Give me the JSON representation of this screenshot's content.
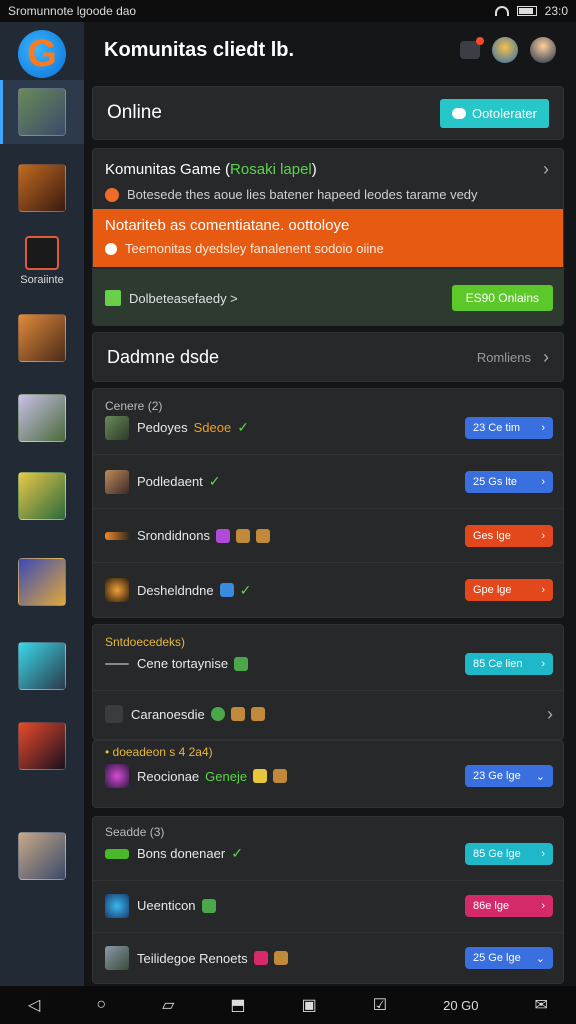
{
  "statusbar": {
    "left_text": "Sromunnote lgoode dao",
    "time": "23:0"
  },
  "sidebar": {
    "label": "Soraiinte",
    "logo_glyph": "G"
  },
  "header": {
    "title": "Komunitas cliedt lb."
  },
  "online": {
    "title": "Online",
    "button": "Ootolerater"
  },
  "community": {
    "title_prefix": "Komunitas Game (",
    "title_highlight": "Rosaki lapel",
    "title_suffix": ")",
    "subtitle": "Botesede thes aoue lies batener hapeed leodes tarame vedy",
    "alert_title": "Notariteb as comentiatane. oottoloye",
    "alert_sub": "Teemonitas dyedsley fanalenent sodoio oiine",
    "status_text": "Dolbeteasefaedy >",
    "status_button": "ES90 Onlains"
  },
  "section_header": {
    "title": "Dadmne dsde",
    "right": "Romliens"
  },
  "group1": {
    "title": "Cenere (2)",
    "rows": [
      {
        "name": "Pedoyes",
        "tag": "Sdeoe",
        "pill": "23 Ce tim",
        "color": "#3a6fe0"
      },
      {
        "name": "Podledaent",
        "tag": "",
        "pill": "25 Gs lte",
        "color": "#3a6fe0"
      },
      {
        "name": "Srondidnons",
        "tag": "",
        "pill": "Ges lge",
        "color": "#e2481c"
      },
      {
        "name": "Desheldndne",
        "tag": "",
        "pill": "Gpe lge",
        "color": "#e2481c"
      }
    ]
  },
  "group2": {
    "title": "Sntdoecedeks)",
    "rows": [
      {
        "name": "Cene tortaynise",
        "pill": "85 Ce lien",
        "color": "#1eb8c8"
      },
      {
        "name": "Caranoesdie",
        "pill": "",
        "color": ""
      }
    ]
  },
  "group3": {
    "title": "• doeadeon s 4 2a4)",
    "rows": [
      {
        "name": "Reocionae",
        "tag": "Geneje",
        "pill": "23 Ge lge",
        "color": "#3a6fe0"
      }
    ]
  },
  "group4": {
    "title": "Seadde (3)",
    "rows": [
      {
        "name": "Bons donenaer",
        "pill": "85 Ge lge",
        "color": "#1eb8c8"
      },
      {
        "name": "Ueenticon",
        "pill": "86e lge",
        "color": "#d42a6a"
      },
      {
        "name": "Teilidegoe Renoets",
        "pill": "25 Ge lge",
        "color": "#3a6fe0"
      }
    ]
  },
  "navbar": {
    "clock": "20 G0"
  }
}
